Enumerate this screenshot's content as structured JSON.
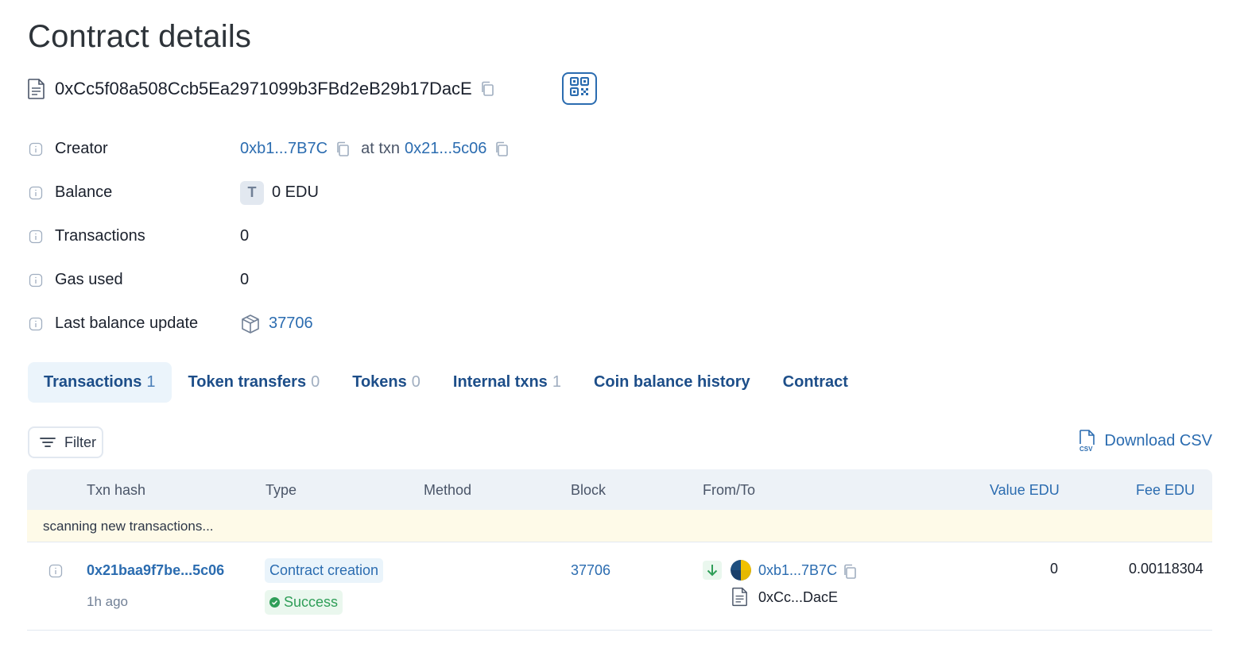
{
  "page": {
    "title": "Contract details"
  },
  "address": {
    "full": "0xCc5f08a508Ccb5Ea2971099b3FBd2eB29b17DacE",
    "icons": [
      "file-document-icon",
      "copy-icon",
      "qr-code-icon"
    ]
  },
  "details": {
    "creator": {
      "label": "Creator",
      "address": "0xb1...7B7C",
      "at_txn_label": "at txn",
      "txn": "0x21...5c06"
    },
    "balance": {
      "label": "Balance",
      "token_letter": "T",
      "value": "0 EDU"
    },
    "transactions": {
      "label": "Transactions",
      "value": "0"
    },
    "gas_used": {
      "label": "Gas used",
      "value": "0"
    },
    "last_balance_update": {
      "label": "Last balance update",
      "block": "37706"
    }
  },
  "tabs": [
    {
      "label": "Transactions",
      "count": "1",
      "active": true
    },
    {
      "label": "Token transfers",
      "count": "0",
      "active": false
    },
    {
      "label": "Tokens",
      "count": "0",
      "active": false
    },
    {
      "label": "Internal txns",
      "count": "1",
      "active": false
    },
    {
      "label": "Coin balance history",
      "count": "",
      "active": false
    },
    {
      "label": "Contract",
      "count": "",
      "active": false
    }
  ],
  "toolbar": {
    "filter_label": "Filter",
    "download_label": "Download CSV"
  },
  "table": {
    "headers": {
      "txn_hash": "Txn hash",
      "type": "Type",
      "method": "Method",
      "block": "Block",
      "from_to": "From/To",
      "value": "Value EDU",
      "fee": "Fee EDU"
    },
    "scanning_text": "scanning new transactions...",
    "rows": [
      {
        "hash": "0x21baa9f7be...5c06",
        "time": "1h ago",
        "type": "Contract creation",
        "status": "Success",
        "method": "",
        "block": "37706",
        "from": "0xb1...7B7C",
        "to": "0xCc...DacE",
        "value": "0",
        "fee": "0.00118304"
      }
    ]
  },
  "colors": {
    "link": "#2b6cb0",
    "tab_text": "#1d4e89",
    "active_tab_bg": "#ebf4fb",
    "success": "#2f9e58",
    "scan_bg": "#fefae8"
  }
}
